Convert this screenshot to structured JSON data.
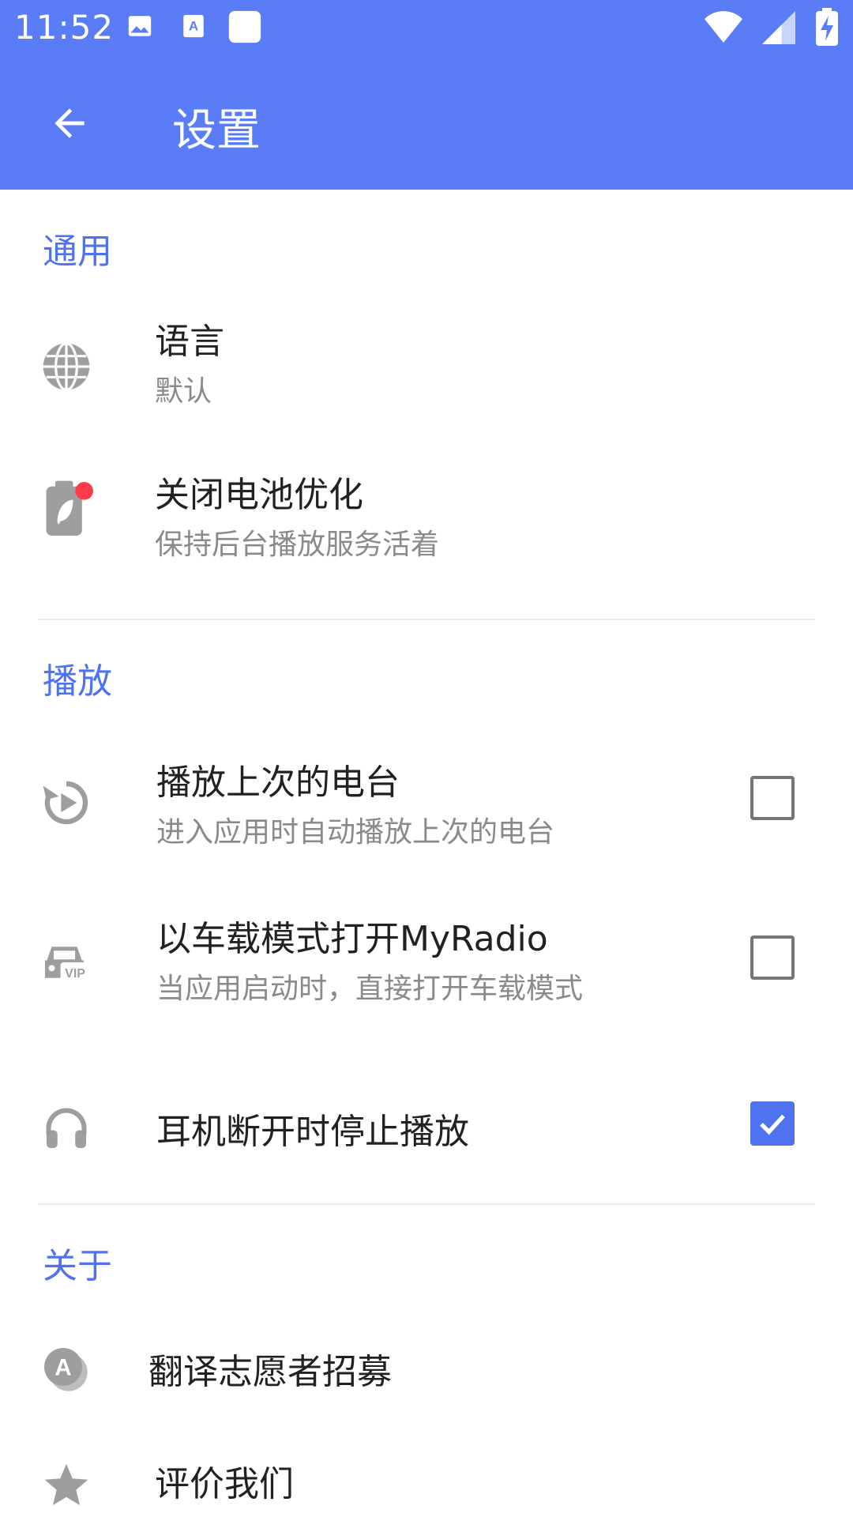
{
  "status_bar": {
    "time": "11:52",
    "icons": [
      "image-icon",
      "translate-a-icon",
      "blank-square-icon",
      "wifi-icon",
      "cell-signal-icon",
      "battery-charging-icon"
    ]
  },
  "app_bar": {
    "title": "设置",
    "back_icon": "arrow-left-icon"
  },
  "sections": {
    "general": {
      "header": "通用",
      "language": {
        "title": "语言",
        "summary": "默认",
        "icon": "globe-icon"
      },
      "battery": {
        "title": "关闭电池优化",
        "summary": "保持后台播放服务活着",
        "icon": "battery-leaf-icon"
      }
    },
    "playback": {
      "header": "播放",
      "play_last": {
        "title": "播放上次的电台",
        "summary": "进入应用时自动播放上次的电台",
        "checked": false,
        "icon": "replay-icon"
      },
      "car_mode": {
        "title": "以车载模式打开MyRadio",
        "summary": "当应用启动时，直接打开车载模式",
        "checked": false,
        "icon": "car-vip-icon"
      },
      "headphone": {
        "title": "耳机断开时停止播放",
        "checked": true,
        "icon": "headphones-icon"
      }
    },
    "about": {
      "header": "关于",
      "translate": {
        "title": "翻译志愿者招募",
        "icon": "translate-chat-icon"
      },
      "rate": {
        "title": "评价我们",
        "icon": "star-icon"
      }
    }
  },
  "colors": {
    "primary": "#5a7df7",
    "accent": "#4f73f0",
    "icon_gray": "#9e9e9e",
    "badge_red": "#ff3b4a"
  }
}
